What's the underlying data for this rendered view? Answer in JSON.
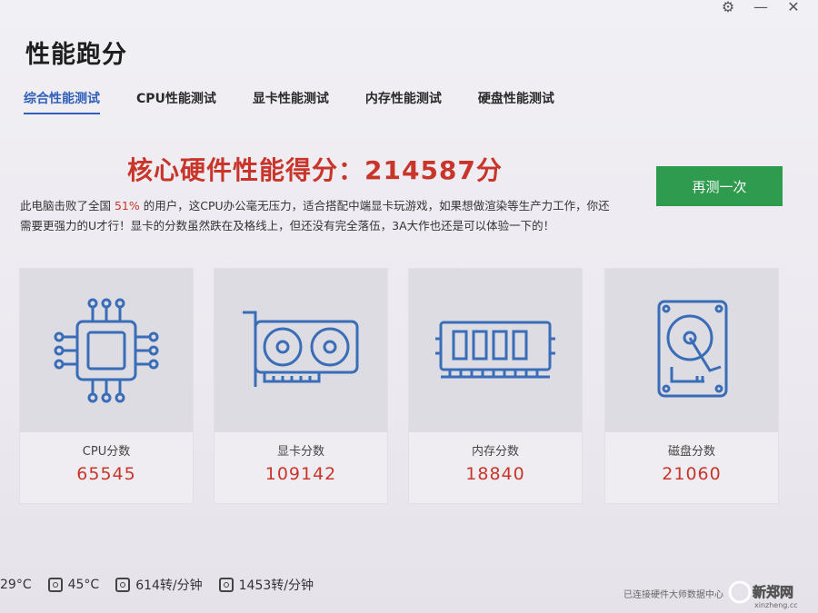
{
  "window": {
    "controls": [
      "gear-icon",
      "minimize-icon",
      "close-icon"
    ]
  },
  "title": "性能跑分",
  "tabs": [
    "综合性能测试",
    "CPU性能测试",
    "显卡性能测试",
    "内存性能测试",
    "硬盘性能测试"
  ],
  "active_tab": 0,
  "score": {
    "text": "核心硬件性能得分：214587分"
  },
  "retest_label": "再测一次",
  "description": {
    "prefix": "此电脑击败了全国 ",
    "percent": "51%",
    "suffix": " 的用户，这CPU办公毫无压力，适合搭配中端显卡玩游戏，如果想做渲染等生产力工作，你还需要更强力的U才行！显卡的分数虽然跌在及格线上，但还没有完全落伍，3A大作也还是可以体验一下的！"
  },
  "cards": [
    {
      "label": "CPU分数",
      "value": "65545",
      "icon": "cpu-icon"
    },
    {
      "label": "显卡分数",
      "value": "109142",
      "icon": "gpu-icon"
    },
    {
      "label": "内存分数",
      "value": "18840",
      "icon": "memory-icon"
    },
    {
      "label": "磁盘分数",
      "value": "21060",
      "icon": "hdd-icon"
    }
  ],
  "status": {
    "temp1": "29°C",
    "temp2": "45°C",
    "fan1": "614转/分钟",
    "fan2": "1453转/分钟"
  },
  "footnote": "已连接硬件大师数据中心",
  "watermark": {
    "name": "新郑网",
    "domain": "xinzheng.cc"
  },
  "colors": {
    "accent_blue": "#2f5fb8",
    "score_red": "#c8362b",
    "button_green": "#2e9b4e",
    "icon_blue": "#3a6db8"
  }
}
